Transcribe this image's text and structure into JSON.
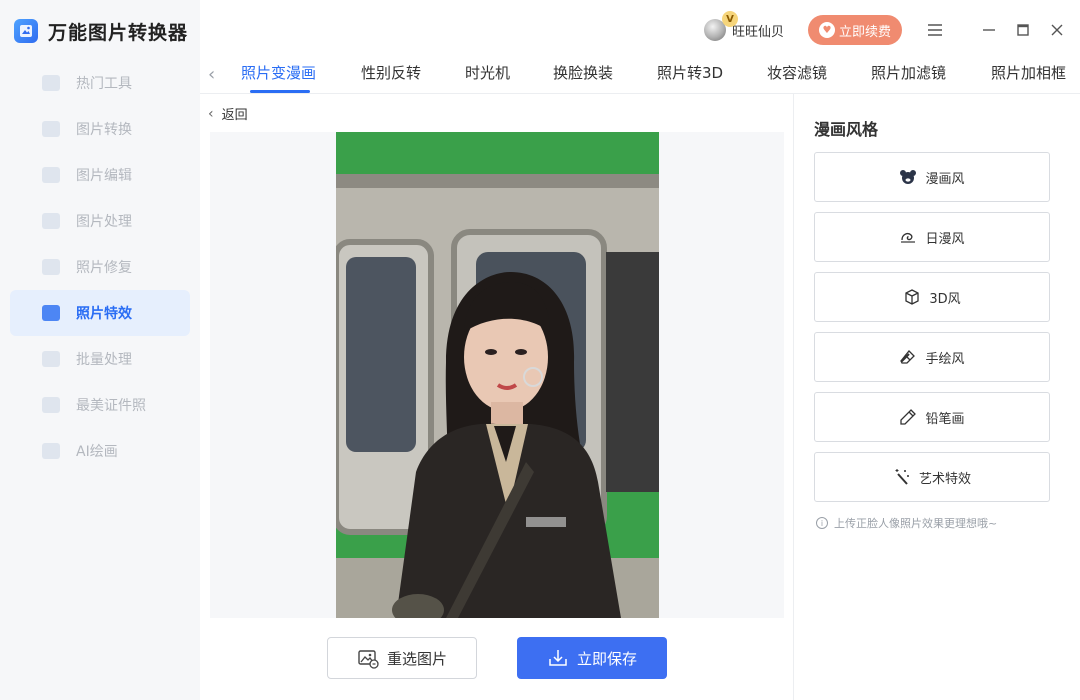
{
  "app": {
    "name": "万能图片转换器"
  },
  "sidebar": {
    "items": [
      {
        "label": "热门工具",
        "icon": "grid-icon"
      },
      {
        "label": "图片转换",
        "icon": "image-convert-icon"
      },
      {
        "label": "图片编辑",
        "icon": "image-edit-icon"
      },
      {
        "label": "图片处理",
        "icon": "image-process-icon"
      },
      {
        "label": "照片修复",
        "icon": "photo-repair-icon"
      },
      {
        "label": "照片特效",
        "icon": "photo-effect-icon",
        "active": true
      },
      {
        "label": "批量处理",
        "icon": "batch-icon"
      },
      {
        "label": "最美证件照",
        "icon": "id-photo-icon"
      },
      {
        "label": "AI绘画",
        "icon": "ai-paint-icon"
      }
    ]
  },
  "header": {
    "vip_badge": "V",
    "username": "旺旺仙贝",
    "renew_label": "立即续费"
  },
  "tabs": [
    {
      "label": "照片变漫画",
      "active": true
    },
    {
      "label": "性别反转"
    },
    {
      "label": "时光机"
    },
    {
      "label": "换脸换装"
    },
    {
      "label": "照片转3D"
    },
    {
      "label": "妆容滤镜"
    },
    {
      "label": "照片加滤镜"
    },
    {
      "label": "照片加相框"
    }
  ],
  "main": {
    "back_label": "返回",
    "reselect_label": "重选图片",
    "save_label": "立即保存"
  },
  "panel": {
    "title": "漫画风格",
    "styles": [
      {
        "label": "漫画风",
        "icon": "bear-icon"
      },
      {
        "label": "日漫风",
        "icon": "swirl-icon"
      },
      {
        "label": "3D风",
        "icon": "cube-icon"
      },
      {
        "label": "手绘风",
        "icon": "eraser-icon"
      },
      {
        "label": "铅笔画",
        "icon": "pencil-icon"
      },
      {
        "label": "艺术特效",
        "icon": "magic-wand-icon"
      }
    ],
    "hint": "上传正脸人像照片效果更理想哦~"
  },
  "colors": {
    "accent": "#2a6df4",
    "renew": "#f08b70",
    "save": "#3d6ff2"
  }
}
